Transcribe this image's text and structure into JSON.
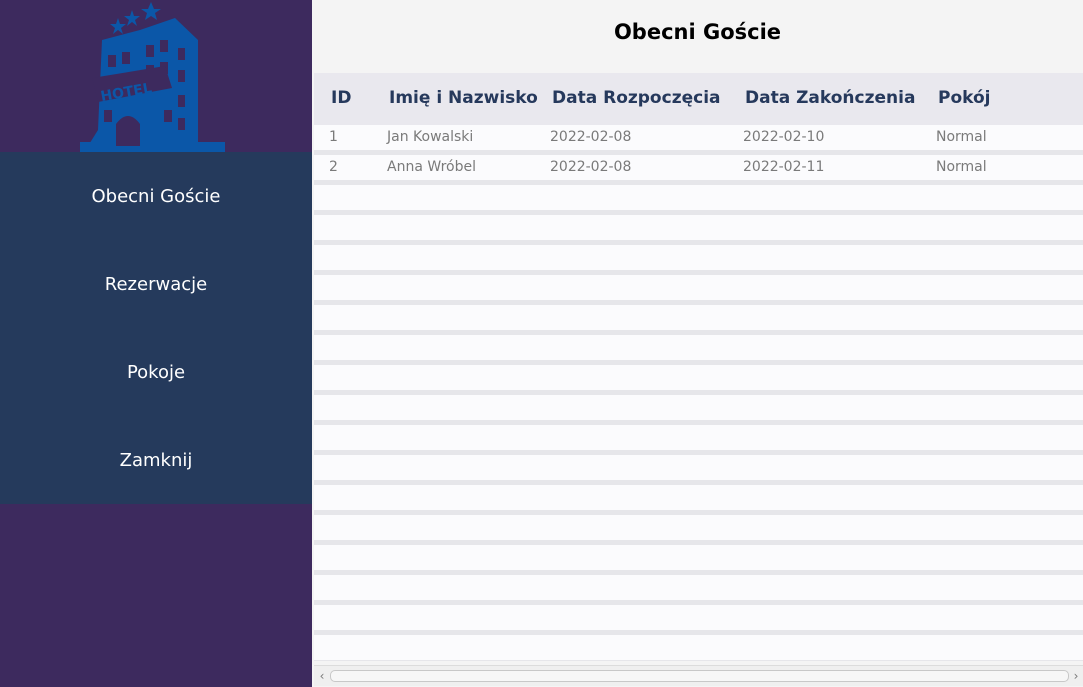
{
  "sidebar": {
    "logo": {
      "text": "HOTEL",
      "icon": "hotel-logo-icon",
      "color": "#0b57a8"
    },
    "items": [
      {
        "label": "Obecni Goście"
      },
      {
        "label": "Rezerwacje"
      },
      {
        "label": "Pokoje"
      },
      {
        "label": "Zamknij"
      }
    ],
    "bg_color": "#3d2a5e",
    "menu_color": "#253a5c"
  },
  "main": {
    "title": "Obecni Goście",
    "table": {
      "columns": [
        "ID",
        "Imię i Nazwisko",
        "Data Rozpoczęcia",
        "Data Zakończenia",
        "Pokój"
      ],
      "rows": [
        [
          "1",
          "Jan Kowalski",
          "2022-02-08",
          "2022-02-10",
          "Normal"
        ],
        [
          "2",
          "Anna Wróbel",
          "2022-02-08",
          "2022-02-11",
          "Normal"
        ]
      ]
    },
    "scrollbar": {
      "left_icon": "chevron-left-icon",
      "right_icon": "chevron-right-icon"
    },
    "header_color": "#26395c"
  }
}
